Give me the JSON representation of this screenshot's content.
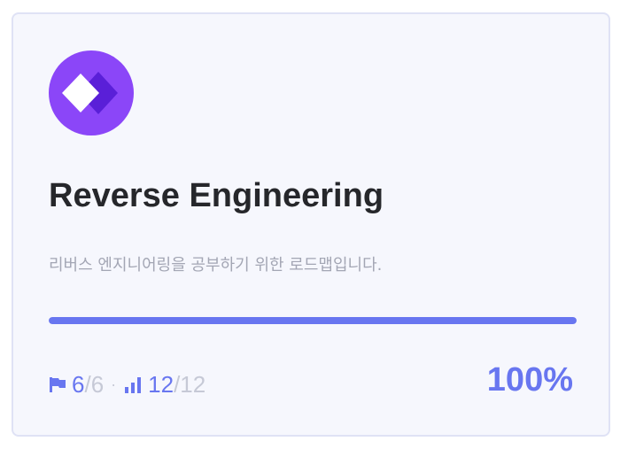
{
  "card": {
    "logo_icon": "diamond-logo-icon",
    "title": "Reverse Engineering",
    "description": "리버스 엔지니어링을 공부하기 위한 로드맵입니다.",
    "progress_fraction": 1.0,
    "stats": {
      "flag_icon": "flag-icon",
      "completed_sections": "6",
      "total_sections": "/6",
      "separator": "·",
      "chart_icon": "bar-chart-icon",
      "completed_items": "12",
      "total_items": "/12"
    },
    "percent_label": "100%"
  },
  "colors": {
    "accent": "#6876f0",
    "logo_bg": "#8b46f8",
    "logo_back_diamond": "#5a1fd8",
    "card_bg": "#f6f7fd",
    "card_border": "#dfe2f5",
    "title": "#26272b",
    "muted": "#a3a6b4"
  }
}
